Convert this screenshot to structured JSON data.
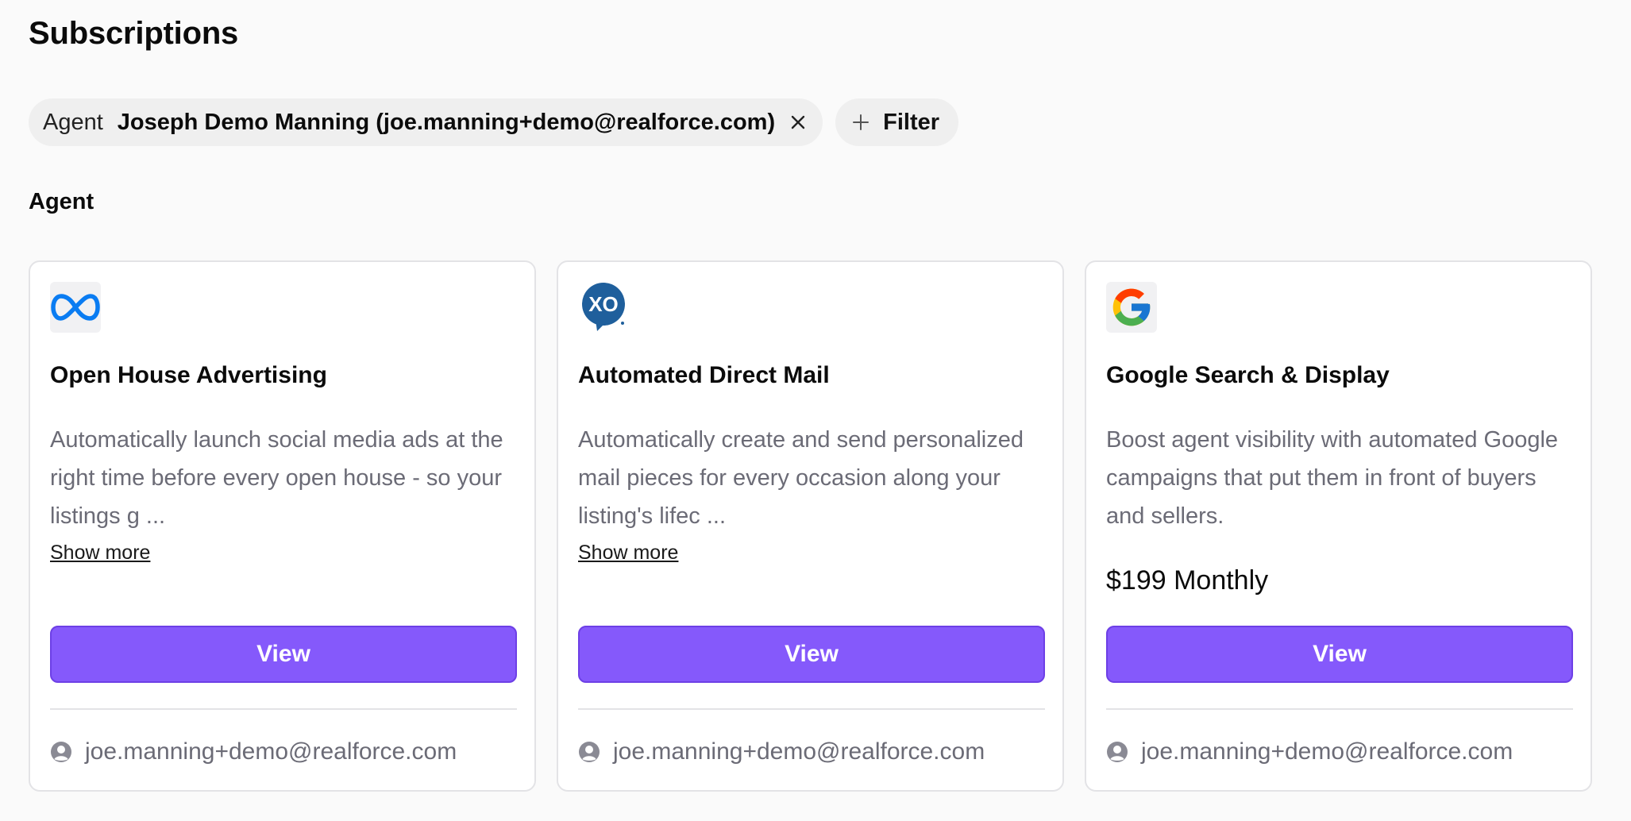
{
  "page": {
    "title": "Subscriptions"
  },
  "filters": {
    "active": {
      "key": "Agent",
      "value": "Joseph Demo Manning (joe.manning+demo@realforce.com)"
    },
    "add_label": "Filter"
  },
  "section": {
    "title": "Agent"
  },
  "cards": [
    {
      "logo": "meta-logo-icon",
      "title": "Open House Advertising",
      "description": "Automatically launch social media ads at the right time before every open house - so your listings g ...",
      "show_more": "Show more",
      "button": "View",
      "owner": "joe.manning+demo@realforce.com"
    },
    {
      "logo": "xo-logo-icon",
      "title": "Automated Direct Mail",
      "description": "Automatically create and send personalized mail pieces for every occasion along your listing's lifec ...",
      "show_more": "Show more",
      "button": "View",
      "owner": "joe.manning+demo@realforce.com"
    },
    {
      "logo": "google-logo-icon",
      "title": "Google Search & Display",
      "description": "Boost agent visibility with automated Google campaigns that put them in front of buyers and sellers.",
      "price": "$199 Monthly",
      "button": "View",
      "owner": "joe.manning+demo@realforce.com"
    }
  ],
  "colors": {
    "accent": "#8559fb",
    "meta_blue": "#0a7cf2",
    "xo_blue": "#1f5f9c"
  }
}
